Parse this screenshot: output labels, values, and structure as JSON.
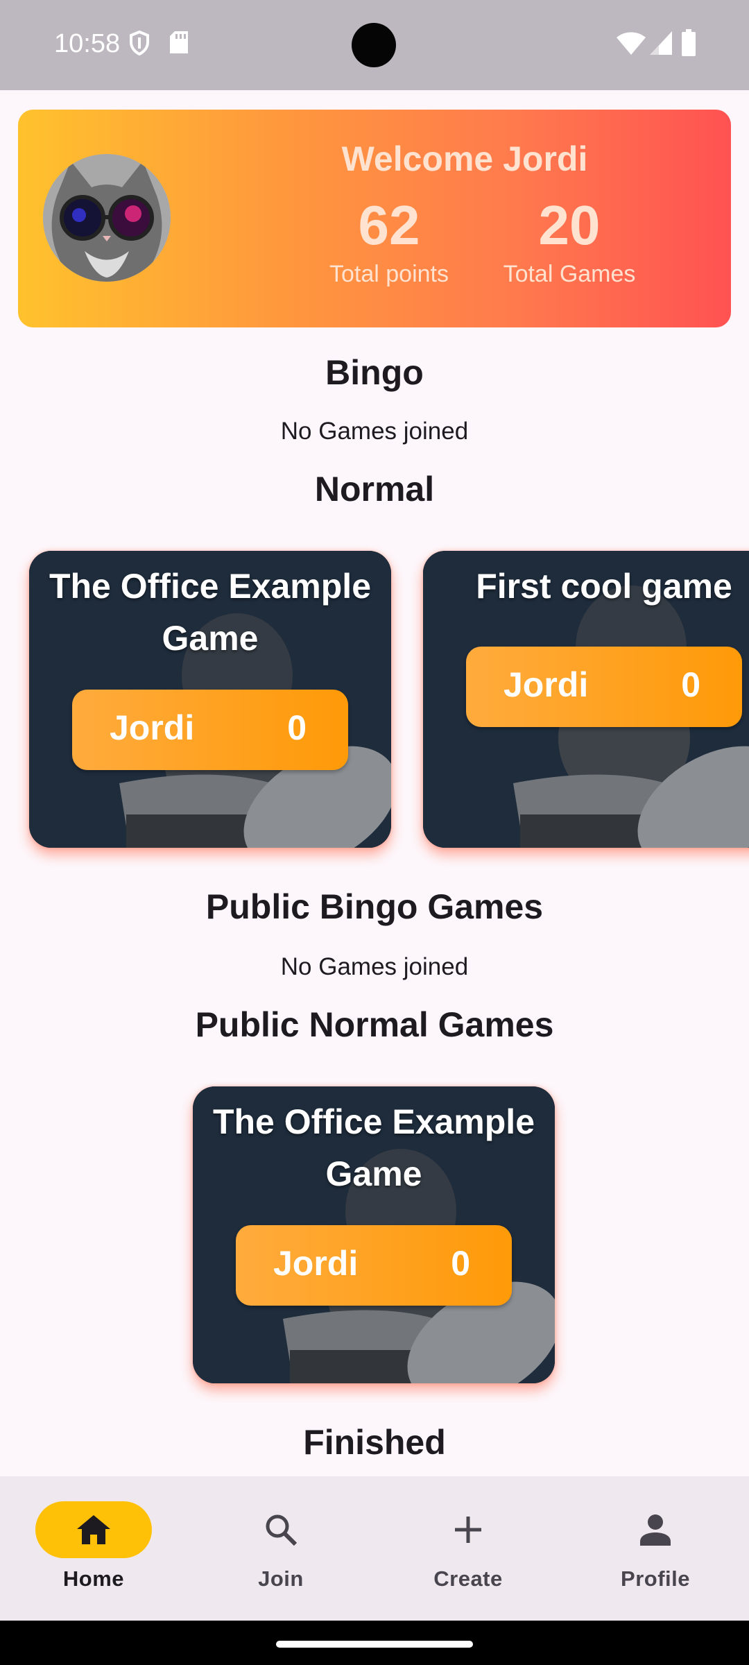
{
  "status_bar": {
    "time": "10:58"
  },
  "profile": {
    "welcome": "Welcome Jordi",
    "total_points": "62",
    "total_points_label": "Total points",
    "total_games": "20",
    "total_games_label": "Total Games"
  },
  "sections": {
    "bingo": {
      "title": "Bingo",
      "empty": "No Games joined"
    },
    "normal": {
      "title": "Normal",
      "games": [
        {
          "title": "The Office Example Game",
          "player": "Jordi",
          "score": "0"
        },
        {
          "title": "First cool game",
          "player": "Jordi",
          "score": "0"
        }
      ]
    },
    "public_bingo": {
      "title": "Public Bingo Games",
      "empty": "No Games joined"
    },
    "public_normal": {
      "title": "Public Normal Games",
      "games": [
        {
          "title": "The Office Example Game",
          "player": "Jordi",
          "score": "0"
        }
      ]
    },
    "finished": {
      "title": "Finished"
    }
  },
  "bottom_nav": [
    {
      "label": "Home",
      "icon": "home-icon",
      "active": true
    },
    {
      "label": "Join",
      "icon": "search-icon",
      "active": false
    },
    {
      "label": "Create",
      "icon": "plus-icon",
      "active": false
    },
    {
      "label": "Profile",
      "icon": "person-icon",
      "active": false
    }
  ],
  "colors": {
    "accent": "#ffc107",
    "pill": "#ff9a08",
    "card_gradient_start": "#ffc22d",
    "card_gradient_end": "#ff5252"
  }
}
